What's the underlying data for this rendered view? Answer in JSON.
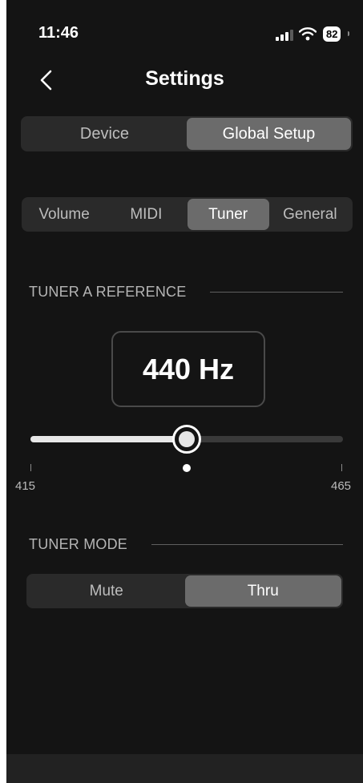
{
  "status_bar": {
    "time": "11:46",
    "battery": "82",
    "signal_icon": "signal-bars-icon",
    "wifi_icon": "wifi-icon"
  },
  "header": {
    "title": "Settings",
    "back_icon": "chevron-left-icon"
  },
  "main_tabs": [
    {
      "label": "Device",
      "active": false
    },
    {
      "label": "Global Setup",
      "active": true
    }
  ],
  "sub_tabs": [
    {
      "label": "Volume",
      "active": false
    },
    {
      "label": "MIDI",
      "active": false
    },
    {
      "label": "Tuner",
      "active": true
    },
    {
      "label": "General",
      "active": false
    }
  ],
  "tuner_reference": {
    "section_label": "TUNER A REFERENCE",
    "value_display": "440 Hz",
    "slider": {
      "min": 415,
      "max": 465,
      "value": 440,
      "min_label": "415",
      "max_label": "465"
    }
  },
  "tuner_mode": {
    "section_label": "TUNER MODE",
    "options": [
      {
        "label": "Mute",
        "active": false
      },
      {
        "label": "Thru",
        "active": true
      }
    ]
  },
  "colors": {
    "background": "#141414",
    "segment_bg": "#2a2a2a",
    "segment_active": "#6b6b6b",
    "slider_fill": "#e8e8e8"
  }
}
